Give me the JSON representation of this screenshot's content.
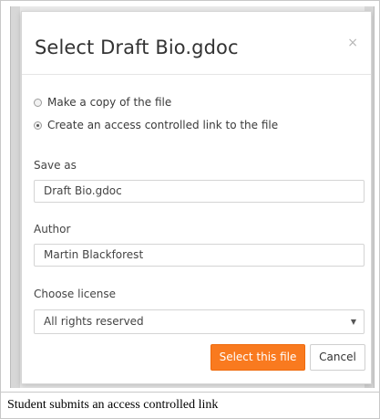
{
  "dialog": {
    "title": "Select Draft Bio.gdoc",
    "close_glyph": "×",
    "options": [
      {
        "label": "Make a copy of the file",
        "checked": false
      },
      {
        "label": "Create an access controlled link to the file",
        "checked": true
      }
    ],
    "save_as": {
      "label": "Save as",
      "value": "Draft Bio.gdoc"
    },
    "author": {
      "label": "Author",
      "value": "Martin Blackforest"
    },
    "license": {
      "label": "Choose license",
      "selected": "All rights reserved",
      "caret": "▼"
    },
    "buttons": {
      "select": "Select this file",
      "cancel": "Cancel"
    },
    "colors": {
      "primary": "#f97a1f",
      "title": "#333333"
    }
  },
  "caption": "Student submits an access controlled link"
}
